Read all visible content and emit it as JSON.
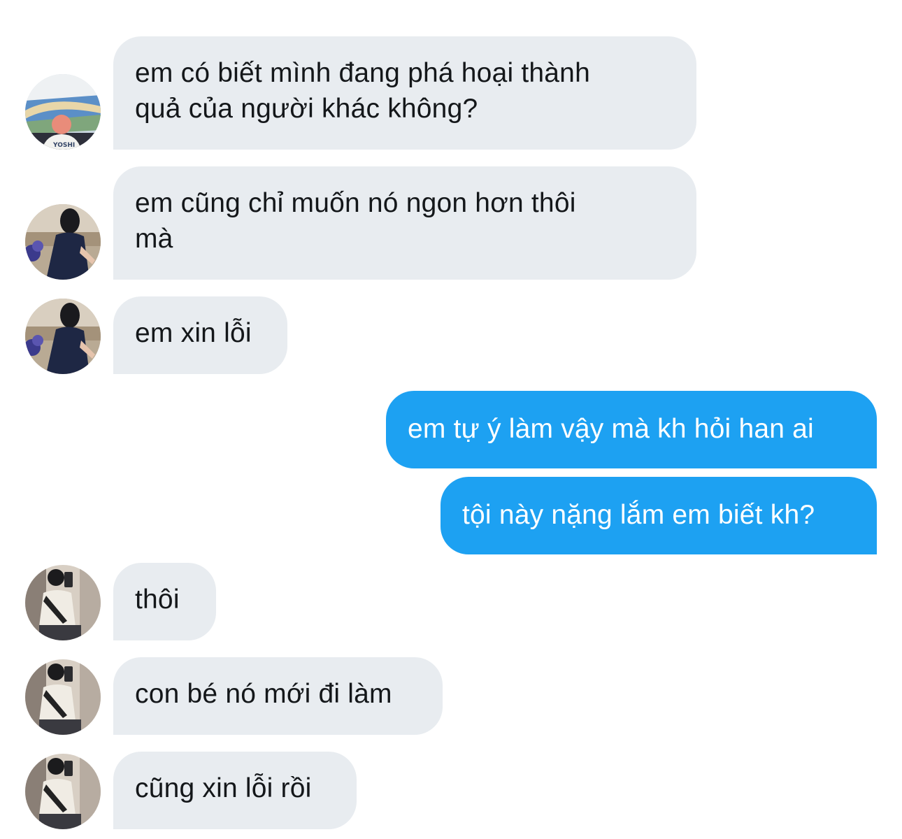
{
  "conversation": {
    "messages": [
      {
        "direction": "incoming",
        "avatar": "stadium-photo-avatar",
        "text": "em có biết mình đang phá hoại thành\nquả của người khác không?"
      },
      {
        "direction": "incoming",
        "avatar": "woman-navy-dress-avatar",
        "text": "em cũng chỉ muốn nó ngon hơn thôi\nmà"
      },
      {
        "direction": "incoming",
        "avatar": "woman-navy-dress-avatar",
        "text": "em xin lỗi"
      },
      {
        "direction": "outgoing",
        "text": "em tự ý làm vậy mà kh hỏi han ai"
      },
      {
        "direction": "outgoing",
        "text": "tội này nặng lắm em biết kh?"
      },
      {
        "direction": "incoming",
        "avatar": "mirror-selfie-avatar",
        "text": "thôi"
      },
      {
        "direction": "incoming",
        "avatar": "mirror-selfie-avatar",
        "text": "con bé nó mới đi làm"
      },
      {
        "direction": "incoming",
        "avatar": "mirror-selfie-avatar",
        "text": "cũng xin lỗi rồi"
      }
    ],
    "avatar_text": {
      "shirt_print": "YOSHI"
    },
    "colors": {
      "incoming_bubble": "#e8ecf0",
      "incoming_text": "#14171a",
      "outgoing_bubble": "#1da1f2",
      "outgoing_text": "#ffffff",
      "background": "#ffffff"
    }
  }
}
